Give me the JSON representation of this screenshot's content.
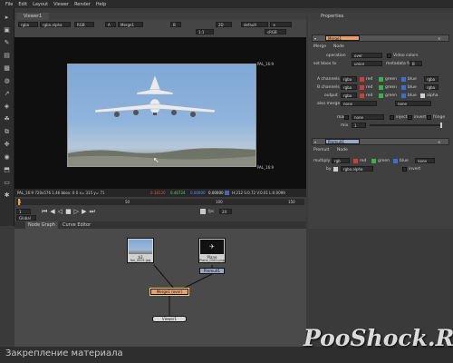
{
  "menu": [
    "File",
    "Edit",
    "Layout",
    "Viewer",
    "Render",
    "Help"
  ],
  "viewer": {
    "tab": "Viewer1",
    "controls": {
      "channels": "rgba",
      "alpha": "rgba.alpha",
      "colorspace": "RGB",
      "input_a": "A",
      "input_a_node": "Merge1",
      "input_b": "B",
      "zoom": "2D",
      "lut": "default",
      "display": "sRGB",
      "proxy": "1:1"
    },
    "format_tr": "PAL_16:9",
    "format_br": "PAL_16:9",
    "status": {
      "info": "PAL_16:9 720x576 1.46 bbox: 0 0  x= 315 y= 71",
      "r": "0.38120",
      "g": "0.46724",
      "b": "0.00000",
      "a": "0.00000",
      "hsv": "H:212 S:0.72 V:0.01 L:0.0099"
    },
    "timeline": {
      "ticks": [
        "1",
        "50",
        "100",
        "150"
      ],
      "current_frame": "1",
      "fps_label": "fps",
      "fps": "24",
      "global": "Global"
    }
  },
  "nodegraph": {
    "tabs": [
      "Node Graph",
      "Curve Editor"
    ],
    "nodes": {
      "read_a_label": "b3",
      "read_a_sub": "fon_0001.jpg",
      "read_b_label": "Plane",
      "read_b_sub": "Plane_0001.png",
      "premult": "Premult1",
      "merge": "Merge1 (over)",
      "viewer": "Viewer1"
    }
  },
  "properties": {
    "title": "Properties",
    "merge_panel": {
      "name": "Merge1",
      "tabs": [
        "Merge",
        "Node"
      ],
      "operation_label": "operation",
      "operation_value": "over",
      "video_colors_label": "Video colors",
      "set_bbox_label": "set bbox to",
      "set_bbox_value": "union",
      "metadata_label": "metadata from",
      "metadata_value": "B",
      "a_channels_label": "A channels",
      "b_channels_label": "B channels",
      "output_label": "output",
      "also_merge_label": "also merge",
      "channel_value": "rgba",
      "red": "red",
      "green": "green",
      "blue": "blue",
      "alpha": "alpha",
      "none": "none",
      "mask_label": "mask",
      "mask_value": "none",
      "inject_label": "inject",
      "invert_label": "invert",
      "fringe_label": "fringe",
      "mix_label": "mix",
      "mix_value": "1"
    },
    "premult_panel": {
      "name": "Premult1",
      "tabs": [
        "Premult",
        "Node"
      ],
      "multiply_label": "multiply",
      "multiply_value": "rgb",
      "red": "red",
      "green": "green",
      "blue": "blue",
      "none": "none",
      "by_label": "by",
      "by_value": "rgba.alpha",
      "invert_label": "invert"
    }
  },
  "footer": {
    "caption": "Закрепление материала",
    "watermark": "PooShock.Ru"
  },
  "colors": {
    "red": "#d23b3b",
    "green": "#3bb14a",
    "blue": "#3b6fd2",
    "merge_node": "#e6a070",
    "viewer_node": "#d8d8d8"
  }
}
